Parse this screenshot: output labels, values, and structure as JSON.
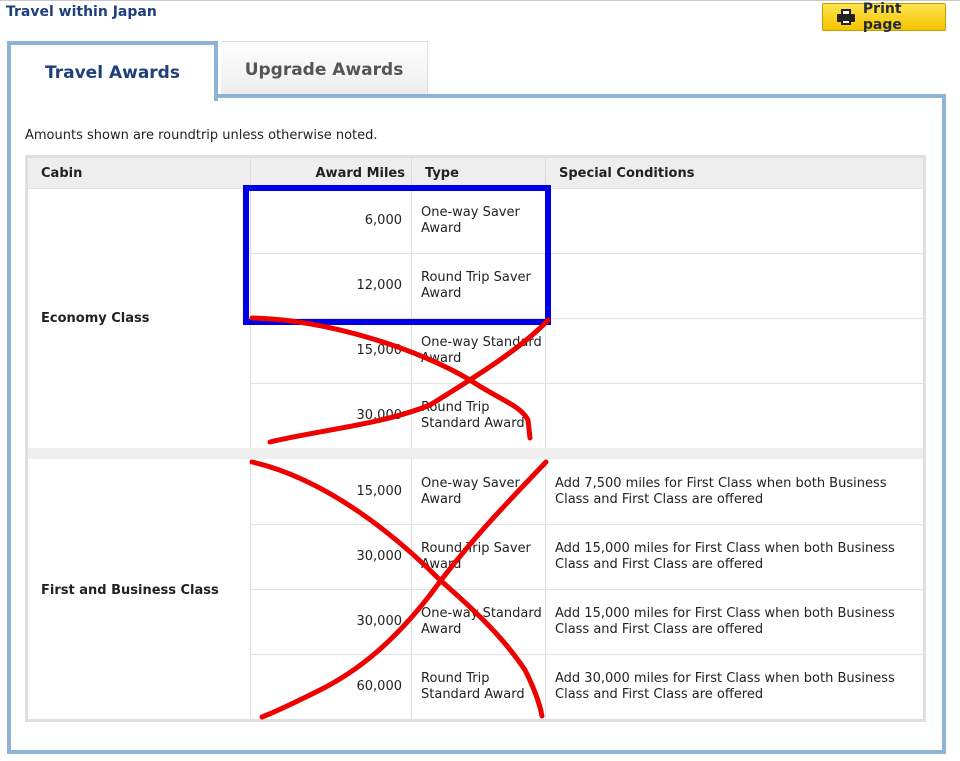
{
  "header": {
    "title": "Travel within Japan",
    "print_label": "Print page"
  },
  "tabs": [
    {
      "label": "Travel Awards",
      "active": true
    },
    {
      "label": "Upgrade Awards",
      "active": false
    }
  ],
  "note": "Amounts shown are roundtrip unless otherwise noted.",
  "table": {
    "columns": [
      "Cabin",
      "Award Miles",
      "Type",
      "Special Conditions"
    ],
    "groups": [
      {
        "cabin": "Economy Class",
        "rows": [
          {
            "miles": "6,000",
            "type": "One-way Saver Award",
            "conditions": ""
          },
          {
            "miles": "12,000",
            "type": "Round Trip Saver Award",
            "conditions": ""
          },
          {
            "miles": "15,000",
            "type": "One-way Standard Award",
            "conditions": ""
          },
          {
            "miles": "30,000",
            "type": "Round Trip Standard Award",
            "conditions": ""
          }
        ]
      },
      {
        "cabin": "First and Business Class",
        "rows": [
          {
            "miles": "15,000",
            "type": "One-way Saver Award",
            "conditions": "Add 7,500 miles for First Class when both Business Class and First Class are offered"
          },
          {
            "miles": "30,000",
            "type": "Round Trip Saver Award",
            "conditions": "Add 15,000 miles for First Class when both Business Class and First Class are offered"
          },
          {
            "miles": "30,000",
            "type": "One-way Standard Award",
            "conditions": "Add 15,000 miles for First Class when both Business Class and First Class are offered"
          },
          {
            "miles": "60,000",
            "type": "Round Trip Standard Award",
            "conditions": "Add 30,000 miles for First Class when both Business Class and First Class are offered"
          }
        ]
      }
    ]
  },
  "annotations": {
    "highlight_color": "#0000e6",
    "cross_color": "#ee0000"
  }
}
